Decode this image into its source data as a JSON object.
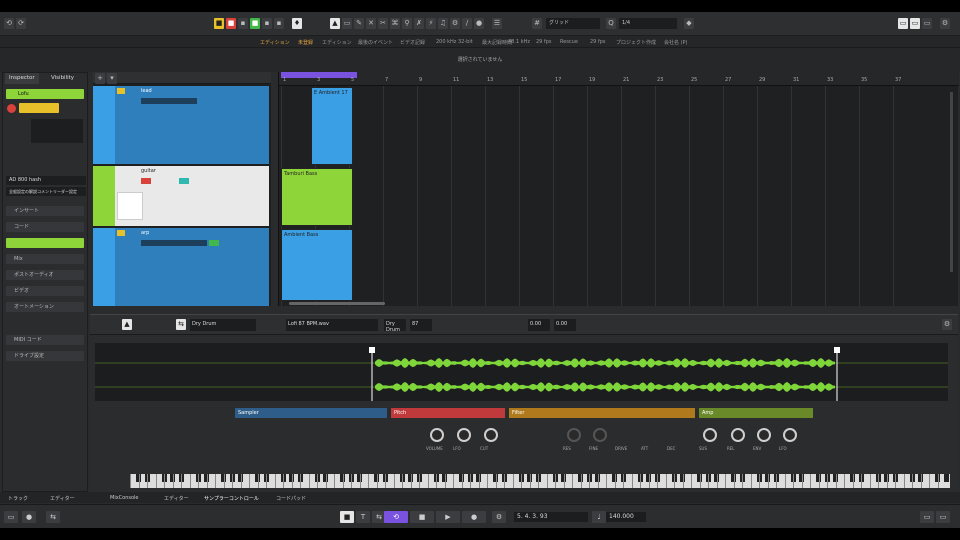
{
  "infobar": {
    "items": [
      "エディション",
      "未登録",
      "エディション",
      "最後のイベント",
      "ビデオ記録",
      "200 kHz 32-bit",
      "最大記録時間",
      "48.1 kHz",
      "29 fps",
      "Rescue",
      "29 fps",
      "プロジェクト作成",
      "会社名 (P)"
    ]
  },
  "status": {
    "text": "選択されていません"
  },
  "toolbar": {
    "grid_label": "グリッド",
    "quantize_value": "1/4"
  },
  "inspector": {
    "tabs": [
      "Inspector",
      "Visibility"
    ],
    "track_name": "Lofu",
    "rows": [
      "インサート",
      "コード",
      "",
      "Mix",
      "ポストオーディオ",
      "ビデオ",
      "オートメーション",
      "MIDI コード",
      "ドライブ設定"
    ],
    "chord_label": "AD 800 hash",
    "route_label": "全般設定の解説コメントリーダー設定"
  },
  "tracks": [
    {
      "name": "lead",
      "color": "#3b9fe6"
    },
    {
      "name": "guitar",
      "color": "#8ed53a"
    },
    {
      "name": "arp",
      "color": "#3b9fe6"
    }
  ],
  "timeline": {
    "markers": [
      "1",
      "3",
      "5",
      "7",
      "9",
      "11",
      "13",
      "15",
      "17",
      "19",
      "21",
      "23",
      "25",
      "27",
      "29",
      "31",
      "33",
      "35",
      "37"
    ]
  },
  "clips": [
    {
      "label": "E Ambient 17"
    },
    {
      "label": "Tamburi Bass"
    },
    {
      "label": "Ambient Bass"
    }
  ],
  "editor": {
    "sample_name": "Dry Drum",
    "file_label": "Lofi 87 BPM.wav",
    "fields": [
      "Dry Drum",
      "87",
      "0.00",
      "0.00"
    ],
    "sections": [
      "Sampler",
      "Pitch",
      "Filter",
      "Amp"
    ],
    "knob_labels": [
      "VOLUME",
      "LFO",
      "CUT",
      "RES",
      "FINE",
      "DRIVE",
      "ATT",
      "DEC",
      "SUS",
      "REL",
      "ENV",
      "LFO"
    ]
  },
  "bottomtabs": [
    "トラック",
    "エディター",
    "MixConsole",
    "エディター",
    "サンプラーコントロール",
    "コードパッド"
  ],
  "transport": {
    "position": "5. 4. 3. 93",
    "tempo": "140.000"
  },
  "colors": {
    "blue": "#3b9fe6",
    "green": "#8ed53a",
    "purple": "#7a52e0",
    "selected": "#e9e9e9"
  }
}
